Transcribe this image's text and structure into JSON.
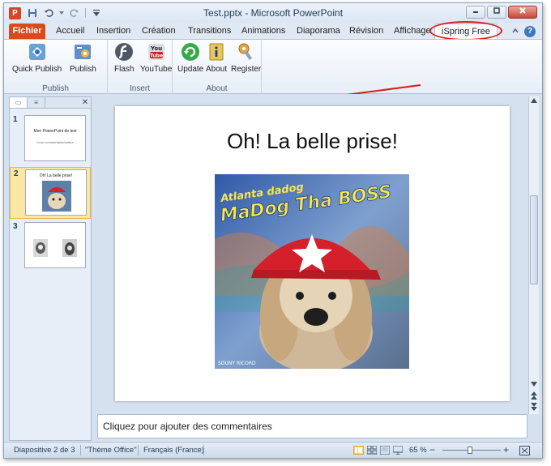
{
  "window": {
    "title": "Test.pptx - Microsoft PowerPoint",
    "app_icon_letter": "P"
  },
  "tabs": [
    {
      "label": "Fichier"
    },
    {
      "label": "Accueil"
    },
    {
      "label": "Insertion"
    },
    {
      "label": "Création"
    },
    {
      "label": "Transitions"
    },
    {
      "label": "Animations"
    },
    {
      "label": "Diaporama"
    },
    {
      "label": "Révision"
    },
    {
      "label": "Affichage"
    },
    {
      "label": "iSpring Free"
    }
  ],
  "ribbon": {
    "groups": [
      {
        "label": "Publish",
        "buttons": [
          {
            "label": "Quick Publish"
          },
          {
            "label": "Publish"
          }
        ]
      },
      {
        "label": "Insert",
        "buttons": [
          {
            "label": "Flash"
          },
          {
            "label": "YouTube"
          }
        ]
      },
      {
        "label": "About",
        "buttons": [
          {
            "label": "Update"
          },
          {
            "label": "About"
          },
          {
            "label": "Register"
          }
        ]
      }
    ]
  },
  "slides": [
    {
      "number": "1",
      "title": "Mon PowerPoint de test",
      "subtitle": "Leon commentaire/auteur"
    },
    {
      "number": "2",
      "title": "Oh! La belle prise!"
    },
    {
      "number": "3",
      "title": ""
    }
  ],
  "current_slide": {
    "title": "Oh! La belle prise!",
    "image_text_top": "Atlanta dadog",
    "image_text_main": "MaDog Tha BOSS",
    "image_credit": "SOUNY RICORD"
  },
  "notes": {
    "placeholder": "Cliquez pour ajouter des commentaires"
  },
  "status": {
    "slide": "Diapositive 2 de 3",
    "theme": "\"Thème Office\"",
    "language": "Français (France)",
    "zoom": "65 %",
    "zoom_minus": "−",
    "zoom_plus": "+"
  },
  "colors": {
    "file_tab": "#d84a1b",
    "annotation": "#d81e1e",
    "selected_thumb": "#fbe7a4"
  }
}
